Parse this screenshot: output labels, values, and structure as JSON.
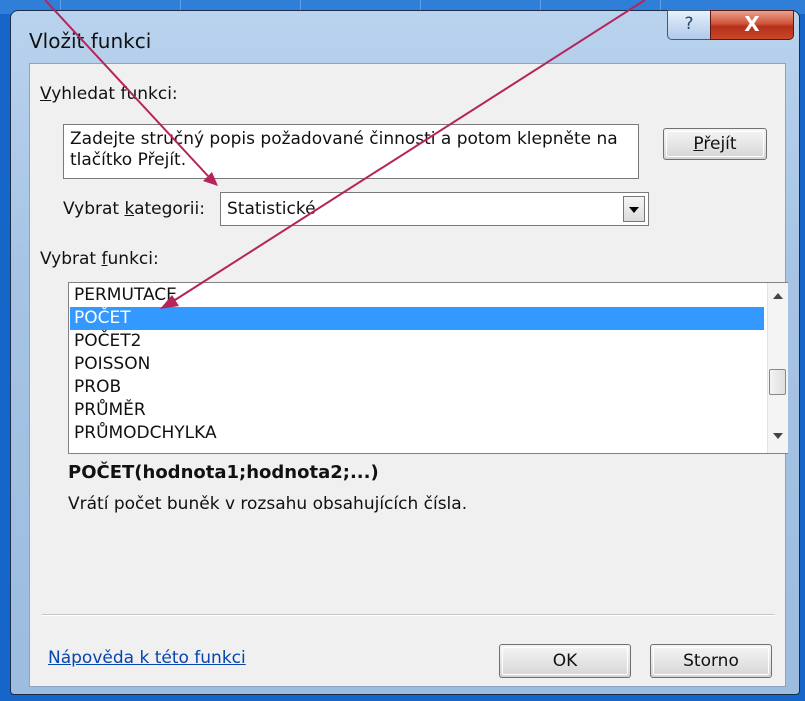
{
  "window": {
    "title": "Vložit funkci",
    "help_glyph": "?",
    "close_glyph": "X"
  },
  "search": {
    "label_underlined": "V",
    "label_rest": "yhledat funkci:",
    "value": "Zadejte stručný popis požadované činnosti a potom klepněte na tlačítko Přejít.",
    "go_label_underlined": "P",
    "go_label_rest": "řejít"
  },
  "category": {
    "label_pre": "Vybrat ",
    "label_underlined": "k",
    "label_rest": "ategorii:",
    "selected": "Statistické"
  },
  "functions": {
    "label_pre": "Vybrat ",
    "label_underlined": "f",
    "label_rest": "unkci:",
    "items": [
      "PERMUTACE",
      "POČET",
      "POČET2",
      "POISSON",
      "PROB",
      "PRŮMĚR",
      "PRŮMODCHYLKA"
    ],
    "selected_index": 1
  },
  "details": {
    "signature": "POČET(hodnota1;hodnota2;...)",
    "description": "Vrátí počet buněk v rozsahu obsahujících čísla."
  },
  "footer": {
    "help_link": "Nápověda k této funkci",
    "ok_label": "OK",
    "cancel_label": "Storno"
  },
  "colors": {
    "selection": "#3399ff",
    "annotation_arrow": "#b5245a",
    "background": "#1566c8"
  }
}
